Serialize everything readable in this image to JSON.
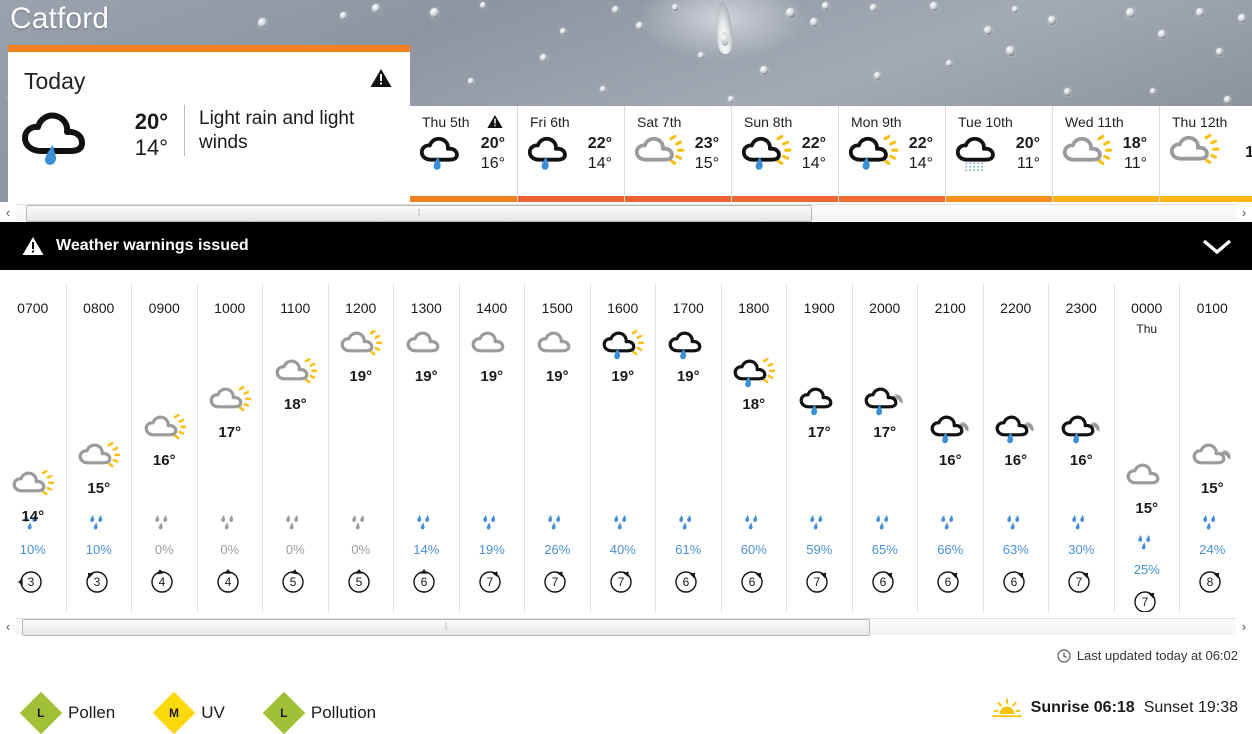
{
  "location": {
    "name": "Catford"
  },
  "today": {
    "title": "Today",
    "high": "20°",
    "low": "14°",
    "description": "Light rain and light winds",
    "icon": "light-rain-icon",
    "has_warning": true
  },
  "days": [
    {
      "label": "Thu 5th",
      "high": "20°",
      "low": "16°",
      "icon": "light-rain-icon",
      "warning": true,
      "bar_color": "#f08020"
    },
    {
      "label": "Fri 6th",
      "high": "22°",
      "low": "14°",
      "icon": "light-rain-icon",
      "warning": false,
      "bar_color": "#ec6436"
    },
    {
      "label": "Sat 7th",
      "high": "23°",
      "low": "15°",
      "icon": "sunny-intervals-icon",
      "warning": false,
      "bar_color": "#ed6235"
    },
    {
      "label": "Sun 8th",
      "high": "22°",
      "low": "14°",
      "icon": "light-rain-sun-icon",
      "warning": false,
      "bar_color": "#ee6634"
    },
    {
      "label": "Mon 9th",
      "high": "22°",
      "low": "14°",
      "icon": "light-rain-sun-icon",
      "warning": false,
      "bar_color": "#ef6c32"
    },
    {
      "label": "Tue 10th",
      "high": "20°",
      "low": "11°",
      "icon": "drizzle-icon",
      "warning": false,
      "bar_color": "#f68f1e"
    },
    {
      "label": "Wed 11th",
      "high": "18°",
      "low": "11°",
      "icon": "sunny-intervals-icon",
      "warning": false,
      "bar_color": "#fbb117"
    },
    {
      "label": "Thu 12th",
      "high": "1",
      "low": "",
      "icon": "sunny-intervals-icon",
      "warning": false,
      "bar_color": "#fcb615"
    }
  ],
  "warning_banner": {
    "text": "Weather warnings issued",
    "icon": "warning-triangle-icon",
    "expand_icon": "chevron-down-icon"
  },
  "hourly": [
    {
      "time": "0700",
      "day": "",
      "icon": "sunny-intervals-icon",
      "temp": "14°",
      "level": 0,
      "precip": "10%",
      "precip_active": true,
      "wind": "3",
      "wind_dir": 90
    },
    {
      "time": "0800",
      "day": "",
      "icon": "sunny-intervals-icon",
      "temp": "15°",
      "level": 1,
      "precip": "10%",
      "precip_active": true,
      "wind": "3",
      "wind_dir": 135
    },
    {
      "time": "0900",
      "day": "",
      "icon": "sunny-intervals-icon",
      "temp": "16°",
      "level": 2,
      "precip": "0%",
      "precip_active": false,
      "wind": "4",
      "wind_dir": 170
    },
    {
      "time": "1000",
      "day": "",
      "icon": "sunny-intervals-icon",
      "temp": "17°",
      "level": 3,
      "precip": "0%",
      "precip_active": false,
      "wind": "4",
      "wind_dir": 180
    },
    {
      "time": "1100",
      "day": "",
      "icon": "sunny-intervals-icon",
      "temp": "18°",
      "level": 4,
      "precip": "0%",
      "precip_active": false,
      "wind": "5",
      "wind_dir": 190
    },
    {
      "time": "1200",
      "day": "",
      "icon": "sunny-intervals-icon",
      "temp": "19°",
      "level": 5,
      "precip": "0%",
      "precip_active": false,
      "wind": "5",
      "wind_dir": 180
    },
    {
      "time": "1300",
      "day": "",
      "icon": "cloudy-icon",
      "temp": "19°",
      "level": 5,
      "precip": "14%",
      "precip_active": true,
      "wind": "6",
      "wind_dir": 180
    },
    {
      "time": "1400",
      "day": "",
      "icon": "cloudy-icon",
      "temp": "19°",
      "level": 5,
      "precip": "19%",
      "precip_active": true,
      "wind": "7",
      "wind_dir": 215
    },
    {
      "time": "1500",
      "day": "",
      "icon": "cloudy-icon",
      "temp": "19°",
      "level": 5,
      "precip": "26%",
      "precip_active": true,
      "wind": "7",
      "wind_dir": 215
    },
    {
      "time": "1600",
      "day": "",
      "icon": "light-rain-sun-icon",
      "temp": "19°",
      "level": 5,
      "precip": "40%",
      "precip_active": true,
      "wind": "7",
      "wind_dir": 215
    },
    {
      "time": "1700",
      "day": "",
      "icon": "light-rain-icon",
      "temp": "19°",
      "level": 5,
      "precip": "61%",
      "precip_active": true,
      "wind": "6",
      "wind_dir": 225
    },
    {
      "time": "1800",
      "day": "",
      "icon": "light-rain-sun-icon",
      "temp": "18°",
      "level": 4,
      "precip": "60%",
      "precip_active": true,
      "wind": "6",
      "wind_dir": 225
    },
    {
      "time": "1900",
      "day": "",
      "icon": "light-rain-icon",
      "temp": "17°",
      "level": 3,
      "precip": "59%",
      "precip_active": true,
      "wind": "7",
      "wind_dir": 225
    },
    {
      "time": "2000",
      "day": "",
      "icon": "light-rain-night-icon",
      "temp": "17°",
      "level": 3,
      "precip": "65%",
      "precip_active": true,
      "wind": "6",
      "wind_dir": 225
    },
    {
      "time": "2100",
      "day": "",
      "icon": "light-rain-night-icon",
      "temp": "16°",
      "level": 2,
      "precip": "66%",
      "precip_active": true,
      "wind": "6",
      "wind_dir": 225
    },
    {
      "time": "2200",
      "day": "",
      "icon": "light-rain-night-icon",
      "temp": "16°",
      "level": 2,
      "precip": "63%",
      "precip_active": true,
      "wind": "6",
      "wind_dir": 225
    },
    {
      "time": "2300",
      "day": "",
      "icon": "light-rain-night-icon",
      "temp": "16°",
      "level": 2,
      "precip": "30%",
      "precip_active": true,
      "wind": "7",
      "wind_dir": 225
    },
    {
      "time": "0000",
      "day": "Thu",
      "icon": "cloudy-icon",
      "temp": "15°",
      "level": 1,
      "precip": "25%",
      "precip_active": true,
      "wind": "7",
      "wind_dir": 225
    },
    {
      "time": "0100",
      "day": "",
      "icon": "cloudy-night-icon",
      "temp": "15°",
      "level": 1,
      "precip": "24%",
      "precip_active": true,
      "wind": "8",
      "wind_dir": 225
    }
  ],
  "footer": {
    "last_updated": "Last updated today at 06:02",
    "clock_icon": "clock-icon",
    "badges": [
      {
        "letter": "L",
        "label": "Pollen",
        "color": "#a2c037"
      },
      {
        "letter": "M",
        "label": "UV",
        "color": "#fbd90a"
      },
      {
        "letter": "L",
        "label": "Pollution",
        "color": "#a2c037"
      }
    ],
    "sun": {
      "icon": "sunrise-icon",
      "sunrise_label": "Sunrise 06:18",
      "sunset_label": "Sunset 19:38"
    }
  },
  "scrollbars": {
    "days": {
      "left_arrow": "‹",
      "right_arrow": "›"
    },
    "hours": {
      "left_arrow": "‹",
      "right_arrow": "›"
    }
  },
  "colors": {
    "accent_orange": "#f58220",
    "precip_blue": "#4a90d9",
    "precip_grey": "#9b9b9b",
    "banner_black": "#000000"
  }
}
